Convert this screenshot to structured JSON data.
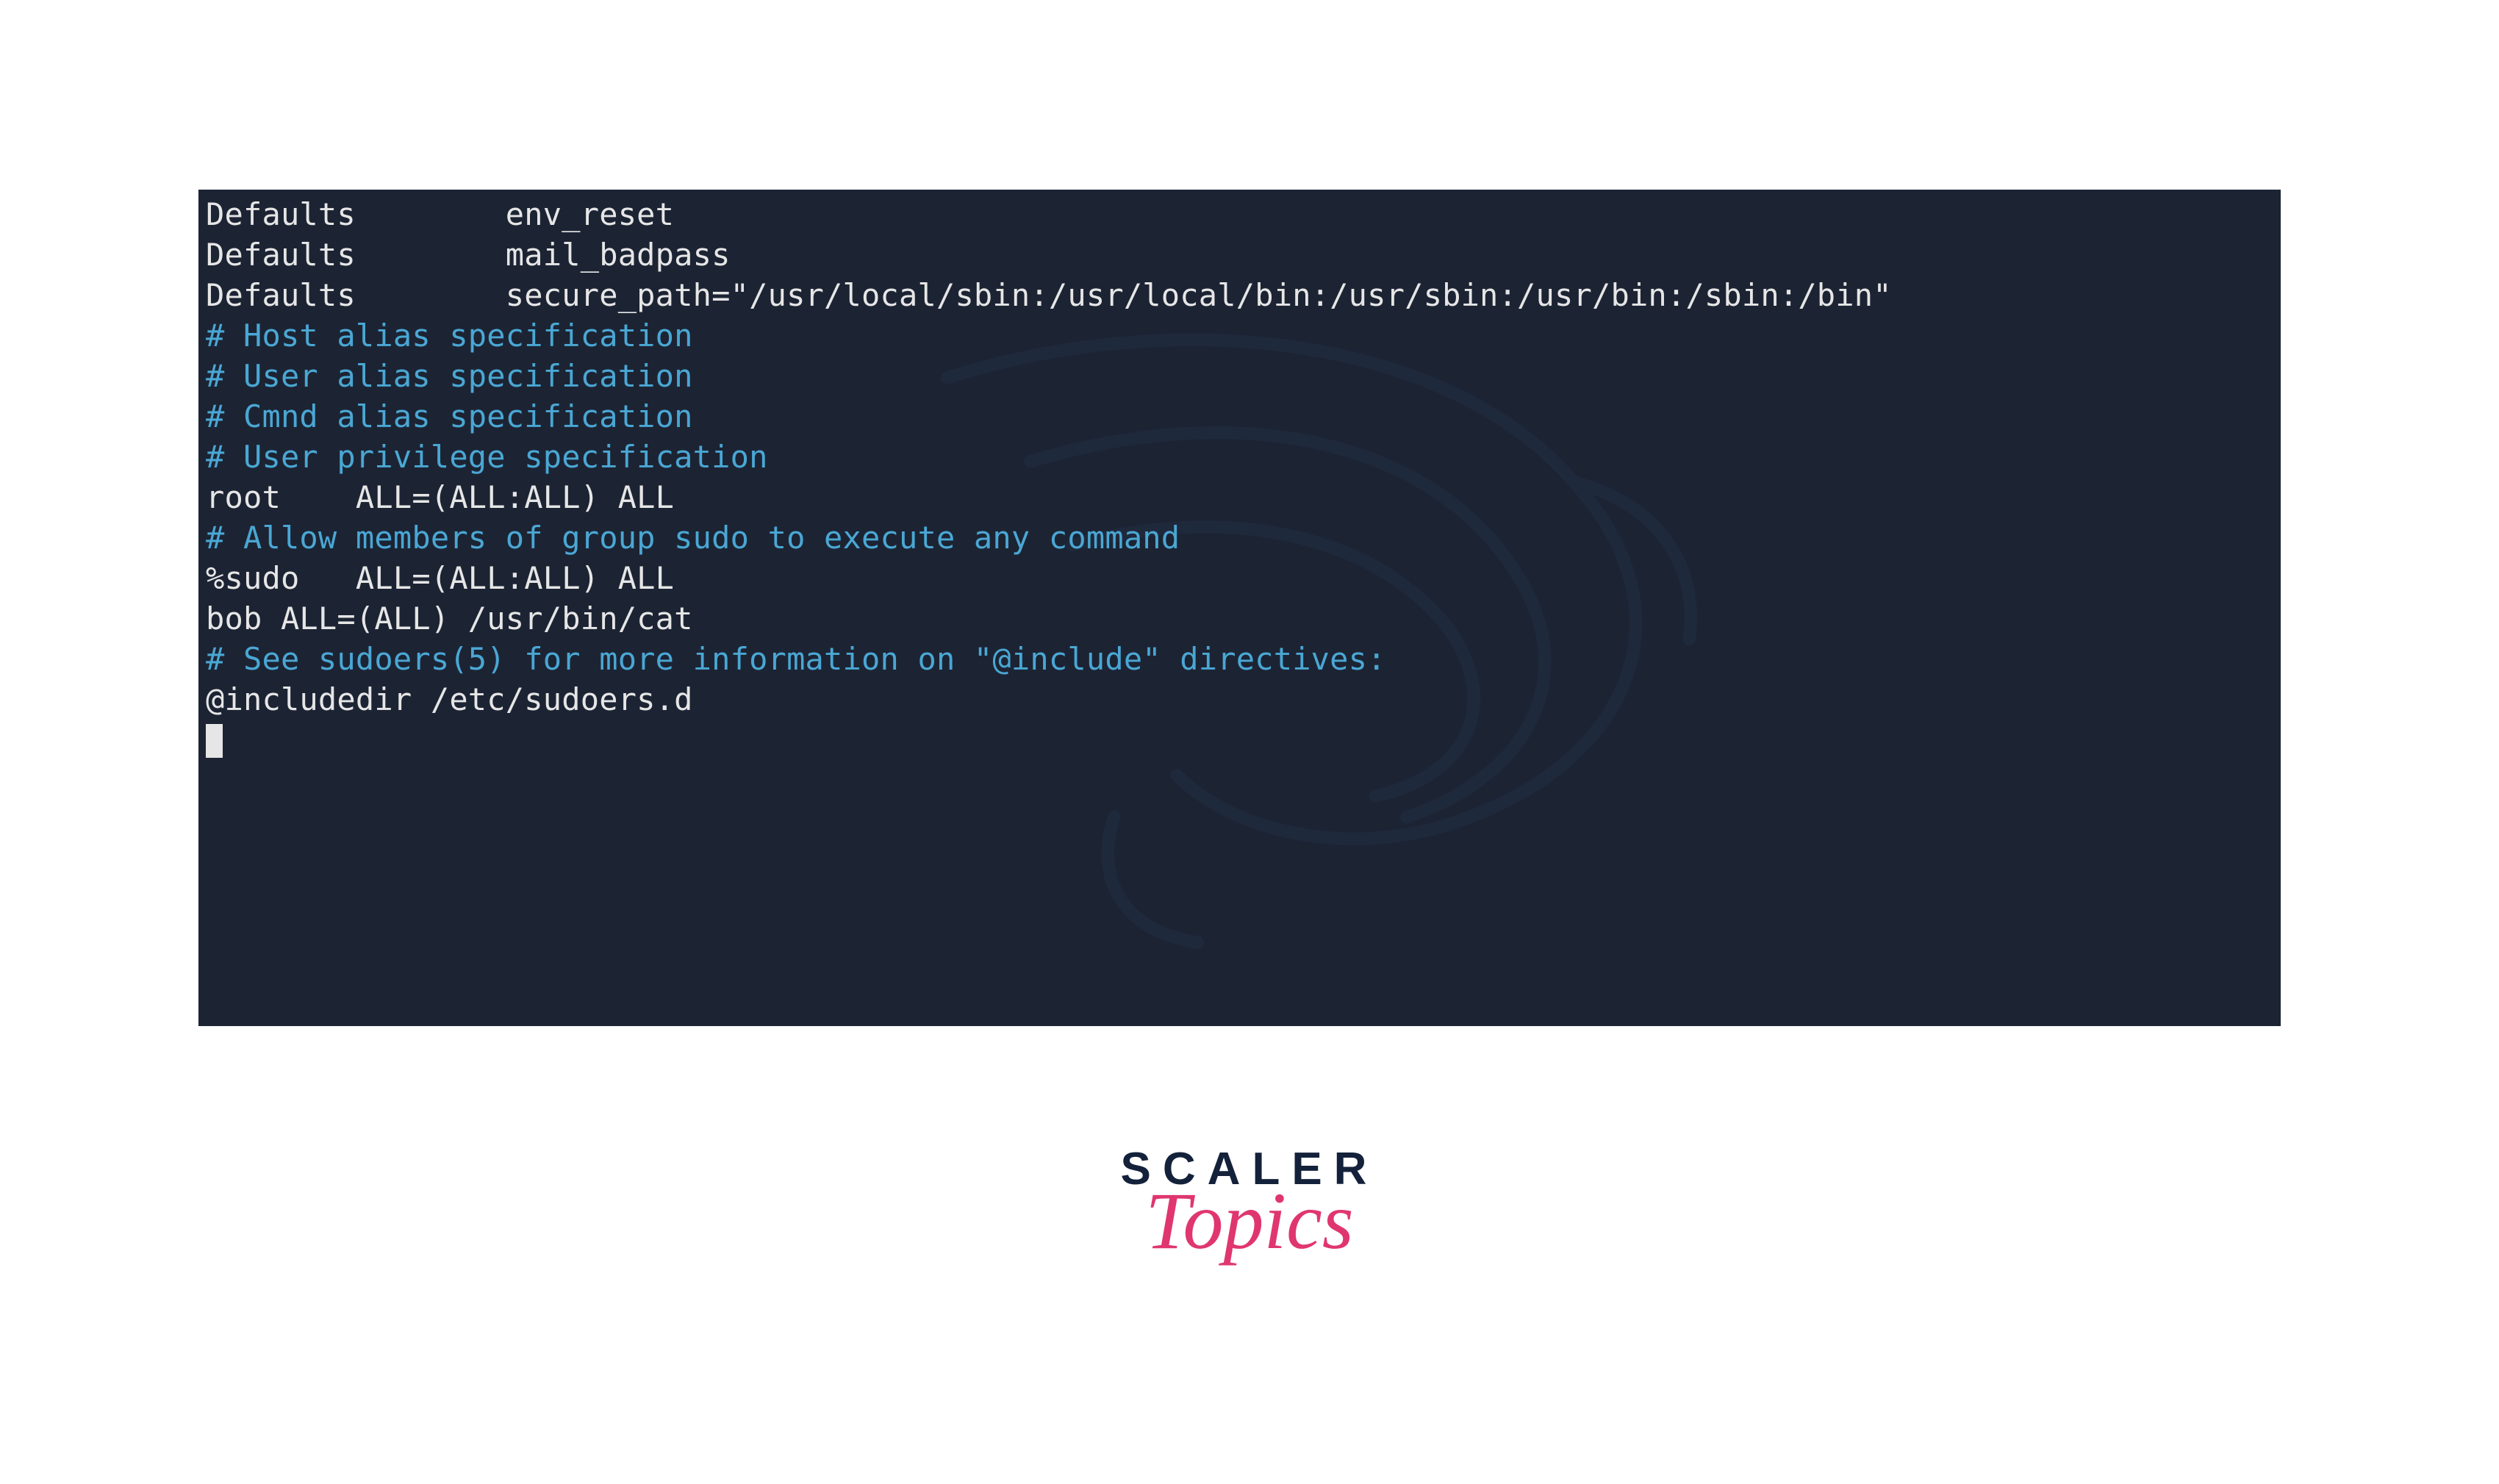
{
  "terminal": {
    "lines": [
      {
        "cls": "plain",
        "text": "Defaults        env_reset"
      },
      {
        "cls": "plain",
        "text": "Defaults        mail_badpass"
      },
      {
        "cls": "plain",
        "text": "Defaults        secure_path=\"/usr/local/sbin:/usr/local/bin:/usr/sbin:/usr/bin:/sbin:/bin\""
      },
      {
        "cls": "plain",
        "text": ""
      },
      {
        "cls": "comment",
        "text": "# Host alias specification"
      },
      {
        "cls": "plain",
        "text": ""
      },
      {
        "cls": "comment",
        "text": "# User alias specification"
      },
      {
        "cls": "plain",
        "text": ""
      },
      {
        "cls": "comment",
        "text": "# Cmnd alias specification"
      },
      {
        "cls": "plain",
        "text": ""
      },
      {
        "cls": "comment",
        "text": "# User privilege specification"
      },
      {
        "cls": "plain",
        "text": "root    ALL=(ALL:ALL) ALL"
      },
      {
        "cls": "plain",
        "text": ""
      },
      {
        "cls": "comment",
        "text": "# Allow members of group sudo to execute any command"
      },
      {
        "cls": "plain",
        "text": "%sudo   ALL=(ALL:ALL) ALL"
      },
      {
        "cls": "plain",
        "text": "bob ALL=(ALL) /usr/bin/cat"
      },
      {
        "cls": "comment",
        "text": "# See sudoers(5) for more information on \"@include\" directives:"
      },
      {
        "cls": "plain",
        "text": ""
      },
      {
        "cls": "plain",
        "text": "@includedir /etc/sudoers.d"
      }
    ]
  },
  "logo": {
    "line1": "SCALER",
    "line2": "Topics"
  },
  "colors": {
    "terminal_bg": "#1c2434",
    "text_plain": "#e6e6e6",
    "text_comment": "#4aa7d4",
    "brand_dark": "#14213a",
    "brand_pink": "#e0366f"
  }
}
